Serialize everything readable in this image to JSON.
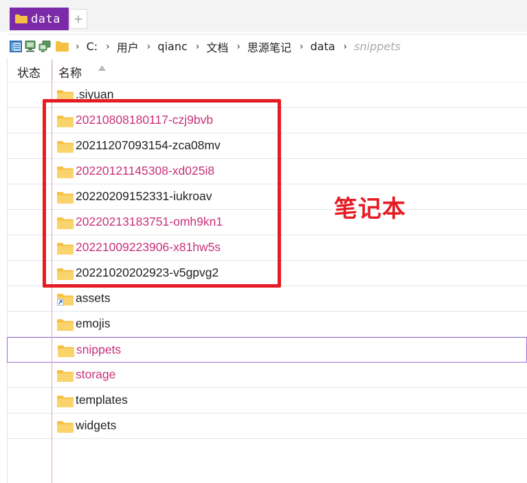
{
  "tab": {
    "label": "data",
    "add_label": "+"
  },
  "address": {
    "crumbs": [
      "C:",
      "用户",
      "qianc",
      "文档",
      "思源笔记",
      "data",
      "snippets"
    ],
    "separator": "›"
  },
  "columns": {
    "status": "状态",
    "name": "名称"
  },
  "files": [
    {
      "name": ".siyuan",
      "highlight": false
    },
    {
      "name": "20210808180117-czj9bvb",
      "highlight": true
    },
    {
      "name": "20211207093154-zca08mv",
      "highlight": false
    },
    {
      "name": "20220121145308-xd025i8",
      "highlight": true
    },
    {
      "name": "20220209152331-iukroav",
      "highlight": false
    },
    {
      "name": "20220213183751-omh9kn1",
      "highlight": true
    },
    {
      "name": "20221009223906-x81hw5s",
      "highlight": true
    },
    {
      "name": "20221020202923-v5gpvg2",
      "highlight": false
    },
    {
      "name": "assets",
      "highlight": false,
      "shortcut": true
    },
    {
      "name": "emojis",
      "highlight": false
    },
    {
      "name": "snippets",
      "highlight": true,
      "selected": true
    },
    {
      "name": "storage",
      "highlight": true
    },
    {
      "name": "templates",
      "highlight": false
    },
    {
      "name": "widgets",
      "highlight": false
    }
  ],
  "annotation": {
    "label": "笔记本"
  },
  "colors": {
    "tab": "#7b2aa8",
    "folder": "#f5c043",
    "highlight_text": "#c8317a",
    "annotation": "#e51c23",
    "selection_border": "#a16ad6"
  },
  "icons": {
    "tab": "folder-icon",
    "toolbar": [
      "pane-layout-icon",
      "computer-icon",
      "network-icon",
      "folder-icon"
    ],
    "sort": "sort-ascending-icon",
    "row": "folder-icon",
    "shortcut_row": "folder-shortcut-icon"
  }
}
